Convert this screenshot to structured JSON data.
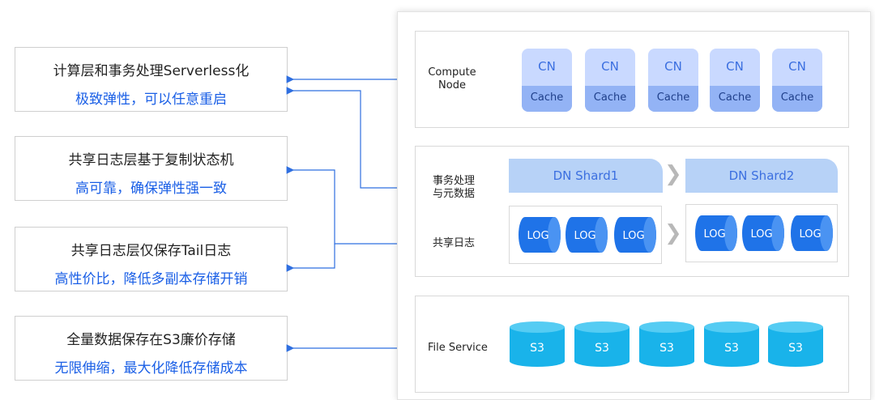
{
  "features": [
    {
      "title": "计算层和事务处理Serverless化",
      "desc": "极致弹性，可以任意重启"
    },
    {
      "title": "共享日志层基于复制状态机",
      "desc": "高可靠，确保弹性强一致"
    },
    {
      "title": "共享日志层仅保存Tail日志",
      "desc": "高性价比，降低多副本存储开销"
    },
    {
      "title": "全量数据保存在S3廉价存储",
      "desc": "无限伸缩，最大化降低存储成本"
    }
  ],
  "compute": {
    "label_line1": "Compute",
    "label_line2": "Node",
    "nodes": [
      {
        "top": "CN",
        "bottom": "Cache"
      },
      {
        "top": "CN",
        "bottom": "Cache"
      },
      {
        "top": "CN",
        "bottom": "Cache"
      },
      {
        "top": "CN",
        "bottom": "Cache"
      },
      {
        "top": "CN",
        "bottom": "Cache"
      }
    ]
  },
  "dn": {
    "label_line1": "事务处理",
    "label_line2": "与元数据",
    "shard1": "DN Shard1",
    "shard2": "DN Shard2",
    "log_label": "共享日志",
    "logs_left": [
      "LOG",
      "LOG",
      "LOG"
    ],
    "logs_right": [
      "LOG",
      "LOG",
      "LOG"
    ]
  },
  "storage": {
    "label": "File Service",
    "items": [
      "S3",
      "S3",
      "S3",
      "S3",
      "S3"
    ]
  },
  "colors": {
    "accent_text": "#1a5fe6",
    "log_blue": "#1f73e8",
    "s3_cyan": "#19b3ea",
    "connector": "#2f6fe0"
  }
}
